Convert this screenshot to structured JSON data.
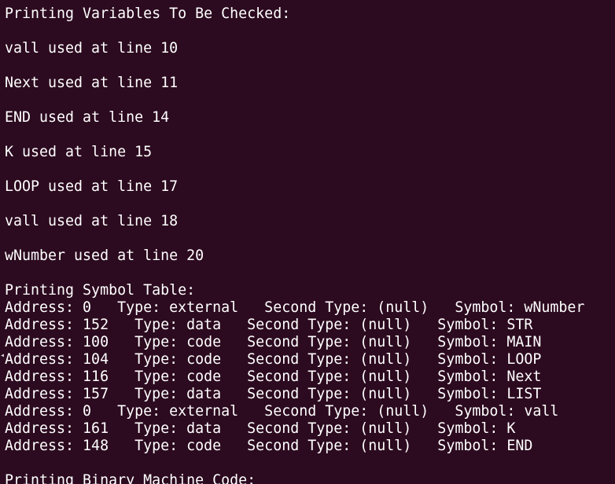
{
  "terminal": {
    "lines": [
      "Printing Variables To Be Checked:",
      "",
      "vall used at line 10",
      "",
      "Next used at line 11",
      "",
      "END used at line 14",
      "",
      "K used at line 15",
      "",
      "LOOP used at line 17",
      "",
      "vall used at line 18",
      "",
      "wNumber used at line 20",
      "",
      "Printing Symbol Table:",
      "Address: 0   Type: external   Second Type: (null)   Symbol: wNumber",
      "Address: 152   Type: data   Second Type: (null)   Symbol: STR",
      "Address: 100   Type: code   Second Type: (null)   Symbol: MAIN",
      "Address: 104   Type: code   Second Type: (null)   Symbol: LOOP",
      "Address: 116   Type: code   Second Type: (null)   Symbol: Next",
      "Address: 157   Type: data   Second Type: (null)   Symbol: LIST",
      "Address: 0   Type: external   Second Type: (null)   Symbol: vall",
      "Address: 161   Type: data   Second Type: (null)   Symbol: K",
      "Address: 148   Type: code   Second Type: (null)   Symbol: END",
      "",
      "Printing Binary Machine Code:"
    ]
  },
  "colors": {
    "background": "#2c0a1f",
    "text": "#ffffff"
  }
}
